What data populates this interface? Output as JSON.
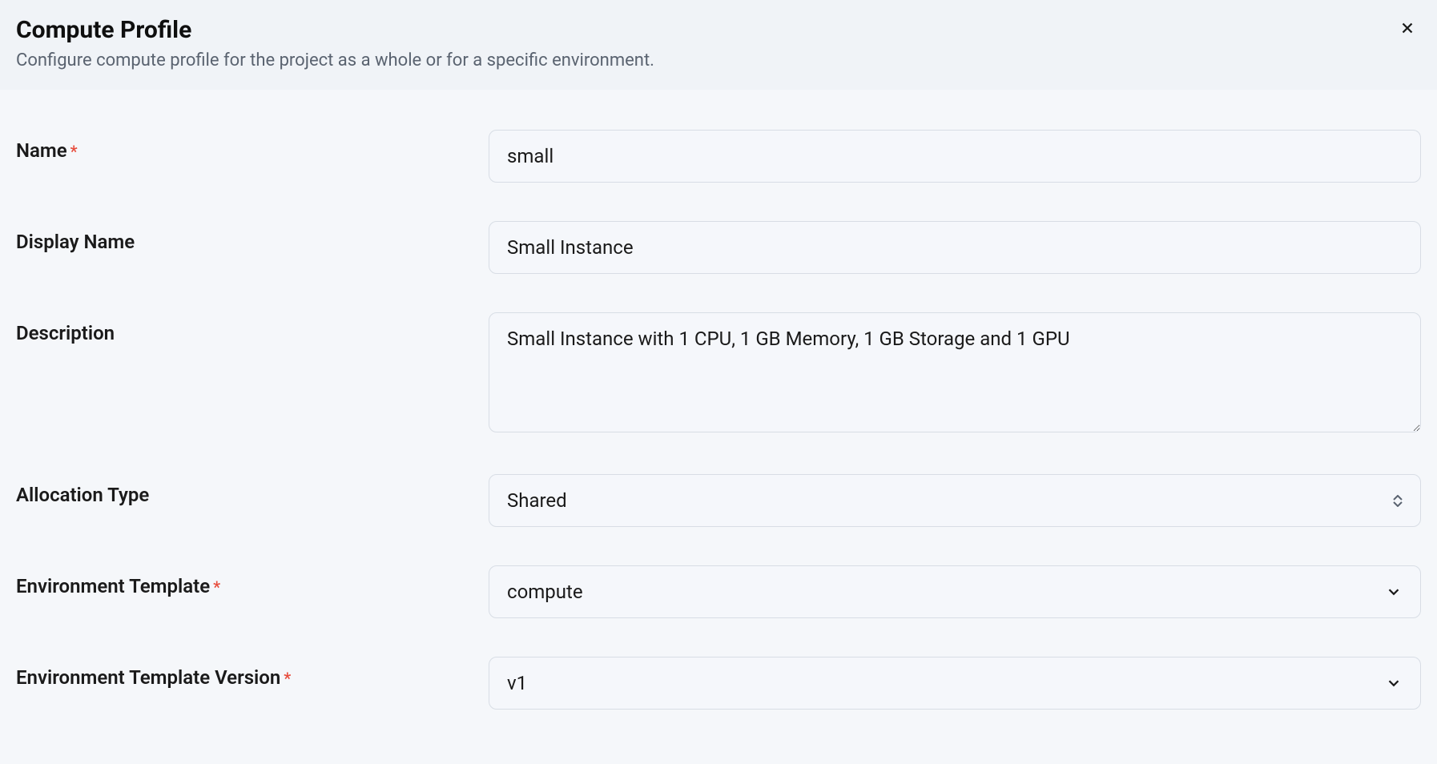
{
  "header": {
    "title": "Compute Profile",
    "subtitle": "Configure compute profile for the project as a whole or for a specific environment."
  },
  "form": {
    "name": {
      "label": "Name",
      "required": "*",
      "value": "small"
    },
    "displayName": {
      "label": "Display Name",
      "value": "Small Instance"
    },
    "description": {
      "label": "Description",
      "value": "Small Instance with 1 CPU, 1 GB Memory, 1 GB Storage and 1 GPU"
    },
    "allocationType": {
      "label": "Allocation Type",
      "value": "Shared"
    },
    "environmentTemplate": {
      "label": "Environment Template",
      "required": "*",
      "value": "compute"
    },
    "environmentTemplateVersion": {
      "label": "Environment Template Version",
      "required": "*",
      "value": "v1"
    }
  }
}
